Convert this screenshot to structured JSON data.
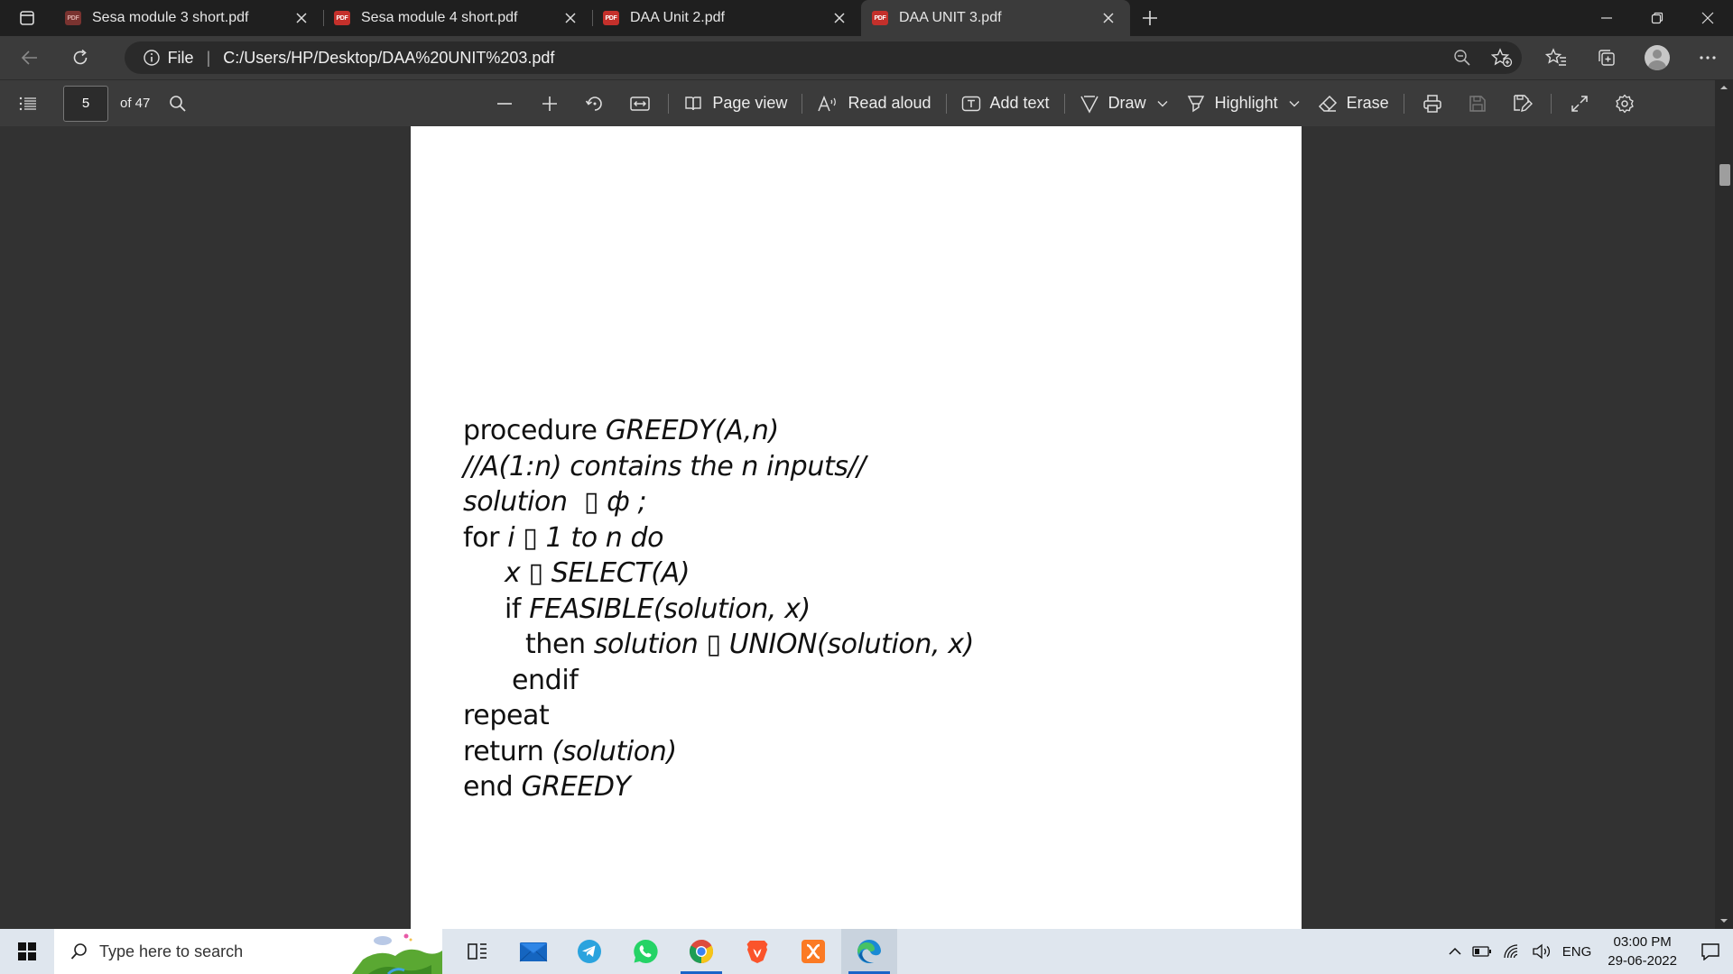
{
  "tabs": [
    {
      "title": "Sesa module 3 short.pdf",
      "active": false,
      "badge": "PDF"
    },
    {
      "title": "Sesa module 4 short.pdf",
      "active": false,
      "badge": "PDF"
    },
    {
      "title": "DAA Unit 2.pdf",
      "active": false,
      "badge": "PDF"
    },
    {
      "title": "DAA UNIT 3.pdf",
      "active": true,
      "badge": "PDF"
    }
  ],
  "address": {
    "scheme_label": "File",
    "url": "C:/Users/HP/Desktop/DAA%20UNIT%203.pdf"
  },
  "pdf_toolbar": {
    "page_current": "5",
    "page_total": "of 47",
    "page_view": "Page view",
    "read_aloud": "Read aloud",
    "add_text": "Add text",
    "draw": "Draw",
    "highlight": "Highlight",
    "erase": "Erase"
  },
  "document": {
    "lines": [
      {
        "indent": 0,
        "parts": [
          [
            "n",
            "procedure "
          ],
          [
            "i",
            "GREEDY(A,n)"
          ]
        ]
      },
      {
        "indent": 0,
        "parts": [
          [
            "i",
            "//A(1:n) contains the n inputs//"
          ]
        ]
      },
      {
        "indent": 0,
        "parts": [
          [
            "i",
            "solution  ▯ ф ;"
          ]
        ]
      },
      {
        "indent": 0,
        "parts": [
          [
            "n",
            "for "
          ],
          [
            "i",
            "i ▯ 1 to n do"
          ]
        ]
      },
      {
        "indent": 1,
        "parts": [
          [
            "i",
            "x ▯ SELECT(A)"
          ]
        ]
      },
      {
        "indent": 1,
        "parts": [
          [
            "n",
            "if "
          ],
          [
            "i",
            "FEASIBLE(solution, x)"
          ]
        ]
      },
      {
        "indent": 2,
        "parts": [
          [
            "n",
            "then "
          ],
          [
            "i",
            "solution ▯ UNION(solution, x)"
          ]
        ]
      },
      {
        "indent": 3,
        "parts": [
          [
            "n",
            "endif"
          ]
        ]
      },
      {
        "indent": 0,
        "parts": [
          [
            "n",
            "repeat"
          ]
        ]
      },
      {
        "indent": 0,
        "parts": [
          [
            "n",
            "return "
          ],
          [
            "i",
            "(solution)"
          ]
        ]
      },
      {
        "indent": 0,
        "parts": [
          [
            "n",
            "end "
          ],
          [
            "i",
            "GREEDY"
          ]
        ]
      }
    ]
  },
  "taskbar": {
    "search_placeholder": "Type here to search",
    "apps": [
      "task-view",
      "mail",
      "telegram",
      "whatsapp",
      "chrome",
      "brave",
      "xampp",
      "edge"
    ],
    "tray_language": "ENG",
    "time": "03:00 PM",
    "date": "29-06-2022"
  },
  "colors": {
    "pdf_badge": "#c4302b",
    "taskbar_bg": "#dfe6ee",
    "toolbar_bg": "#3b3b3b",
    "doc_bg": "#323232"
  }
}
